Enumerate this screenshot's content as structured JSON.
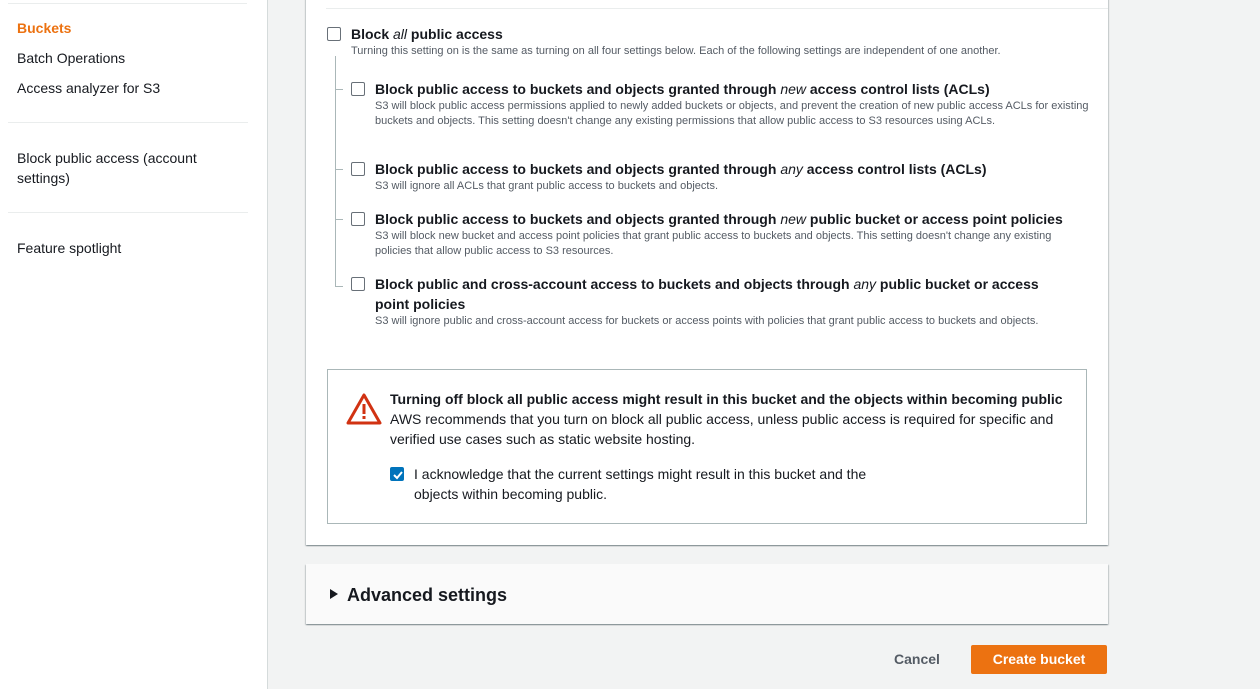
{
  "sidebar": {
    "items": [
      {
        "label": "Buckets",
        "active": true
      },
      {
        "label": "Batch Operations"
      },
      {
        "label": "Access analyzer for S3"
      },
      {
        "label": "Block public access (account settings)"
      },
      {
        "label": "Feature spotlight"
      }
    ]
  },
  "block_all": {
    "title_prefix": "Block ",
    "title_em": "all",
    "title_suffix": " public access",
    "description": "Turning this setting on is the same as turning on all four settings below. Each of the following settings are independent of one another.",
    "checked": false
  },
  "options": [
    {
      "title_prefix": "Block public access to buckets and objects granted through ",
      "title_em": "new",
      "title_suffix": " access control lists (ACLs)",
      "description": "S3 will block public access permissions applied to newly added buckets or objects, and prevent the creation of new public access ACLs for existing buckets and objects. This setting doesn't change any existing permissions that allow public access to S3 resources using ACLs.",
      "checked": false
    },
    {
      "title_prefix": "Block public access to buckets and objects granted through ",
      "title_em": "any",
      "title_suffix": " access control lists (ACLs)",
      "description": "S3 will ignore all ACLs that grant public access to buckets and objects.",
      "checked": false
    },
    {
      "title_prefix": "Block public access to buckets and objects granted through ",
      "title_em": "new",
      "title_suffix": " public bucket or access point policies",
      "description": "S3 will block new bucket and access point policies that grant public access to buckets and objects. This setting doesn't change any existing policies that allow public access to S3 resources.",
      "checked": false
    },
    {
      "title_prefix": "Block public and cross-account access to buckets and objects through ",
      "title_em": "any",
      "title_suffix": " public bucket or access point policies",
      "description": "S3 will ignore public and cross-account access for buckets or access points with policies that grant public access to buckets and objects.",
      "checked": false
    }
  ],
  "warning": {
    "title": "Turning off block all public access might result in this bucket and the objects within becoming public",
    "body": "AWS recommends that you turn on block all public access, unless public access is required for specific and verified use cases such as static website hosting.",
    "ack_label": "I acknowledge that the current settings might result in this bucket and the objects within becoming public.",
    "ack_checked": true
  },
  "advanced": {
    "label": "Advanced settings"
  },
  "footer": {
    "cancel_label": "Cancel",
    "create_label": "Create bucket"
  },
  "colors": {
    "accent": "#ec7211",
    "checkbox_checked": "#0073bb",
    "warning_icon": "#d13212"
  }
}
